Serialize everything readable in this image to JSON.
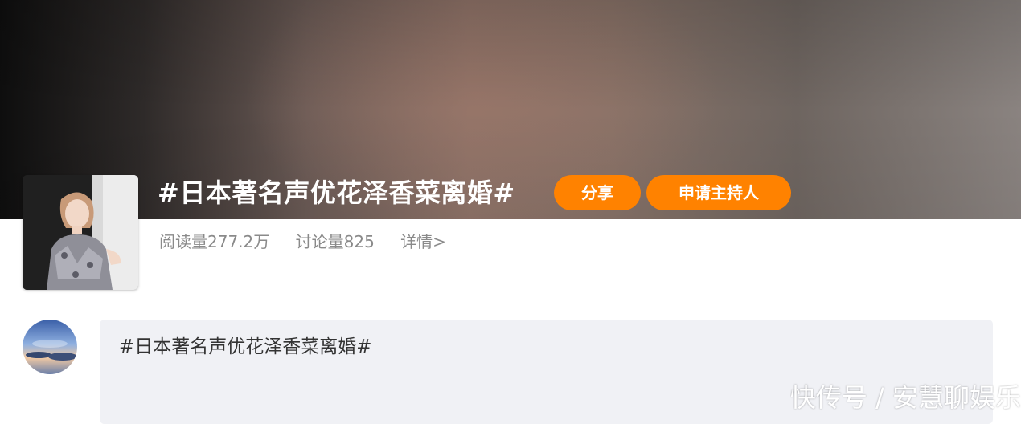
{
  "topic": {
    "title": "#日本著名声优花泽香菜离婚#",
    "share_label": "分享",
    "apply_host_label": "申请主持人",
    "reads": "阅读量277.2万",
    "discussions": "讨论量825",
    "details": "详情>"
  },
  "composer": {
    "text": "#日本著名声优花泽香菜离婚#"
  },
  "watermark": {
    "text": "快传号 / 安慧聊娱乐"
  },
  "colors": {
    "accent": "#ff8200",
    "composer_bg": "#f0f1f5",
    "stats_text": "#8a8a8a"
  }
}
